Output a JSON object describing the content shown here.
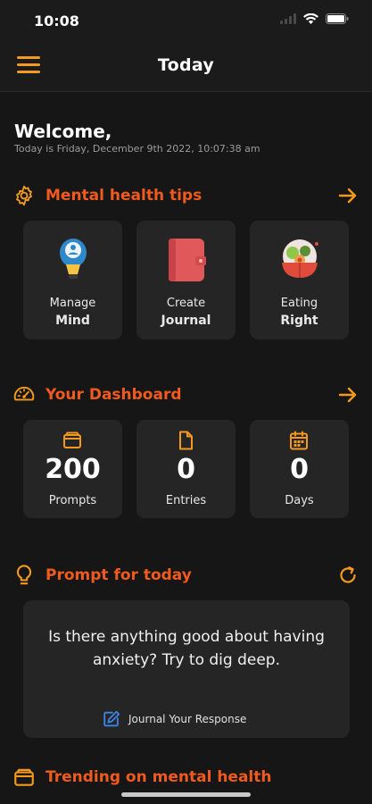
{
  "status_bar": {
    "time": "10:08"
  },
  "nav": {
    "title": "Today"
  },
  "welcome": {
    "title": "Welcome,",
    "date": "Today is Friday, December 9th 2022, 10:07:38 am"
  },
  "tips": {
    "title": "Mental health tips",
    "items": [
      {
        "line1": "Manage",
        "line2": "Mind",
        "icon": "lightbulb-head-icon"
      },
      {
        "line1": "Create",
        "line2": "Journal",
        "icon": "journal-book-icon"
      },
      {
        "line1": "Eating",
        "line2": "Right",
        "icon": "food-bowl-icon"
      }
    ]
  },
  "dashboard": {
    "title": "Your Dashboard",
    "items": [
      {
        "value": "200",
        "label": "Prompts",
        "icon": "box-icon"
      },
      {
        "value": "0",
        "label": "Entries",
        "icon": "document-icon"
      },
      {
        "value": "0",
        "label": "Days",
        "icon": "calendar-icon"
      }
    ]
  },
  "prompt": {
    "title": "Prompt for today",
    "text": "Is there anything good about having anxiety? Try to dig deep.",
    "action_label": "Journal Your Response"
  },
  "trending": {
    "title": "Trending on mental health"
  },
  "colors": {
    "accent": "#f39a1e",
    "title_orange": "#f05a1e",
    "background": "#161616",
    "card": "#252525",
    "link_blue": "#3a86e8"
  }
}
